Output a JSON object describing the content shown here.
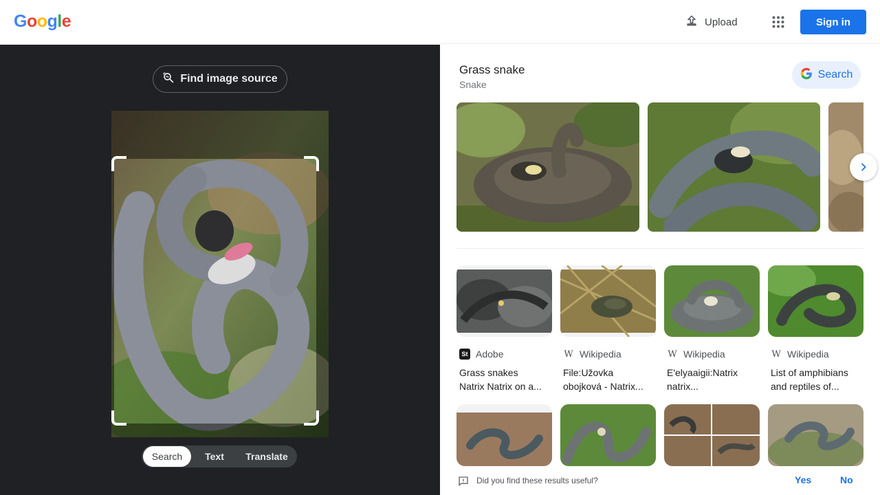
{
  "header": {
    "logo_letters": [
      "G",
      "o",
      "o",
      "g",
      "l",
      "e"
    ],
    "logo_colors": [
      "#4285f4",
      "#ea4335",
      "#fbbc05",
      "#4285f4",
      "#34a853",
      "#ea4335"
    ],
    "upload_label": "Upload",
    "upload_icon": "upload-icon",
    "apps_icon": "apps-grid-icon",
    "signin_label": "Sign in"
  },
  "left_panel": {
    "find_source_label": "Find image source",
    "find_source_icon": "image-search-icon",
    "tabs": [
      {
        "label": "Search",
        "active": true
      },
      {
        "label": "Text",
        "active": false
      },
      {
        "label": "Translate",
        "active": false
      }
    ]
  },
  "knowledge_panel": {
    "title": "Grass snake",
    "subtitle": "Snake",
    "search_label": "Search",
    "search_icon": "google-g-icon",
    "next_icon": "chevron-right-icon"
  },
  "results": [
    {
      "source": "Adobe",
      "favicon": "St",
      "title": "Grass snakes\nNatrix Natrix on a..."
    },
    {
      "source": "Wikipedia",
      "favicon": "W",
      "title": "File:Užovka\nobojková - Natrix..."
    },
    {
      "source": "Wikipedia",
      "favicon": "W",
      "title": "E'elyaaigii:Natrix\nnatrix..."
    },
    {
      "source": "Wikipedia",
      "favicon": "W",
      "title": "List of amphibians\nand reptiles of..."
    }
  ],
  "feedback": {
    "question": "Did you find these results useful?",
    "yes_label": "Yes",
    "no_label": "No",
    "icon": "feedback-icon"
  },
  "colors": {
    "brand_blue": "#1a73e8",
    "dark_panel": "#202124"
  }
}
